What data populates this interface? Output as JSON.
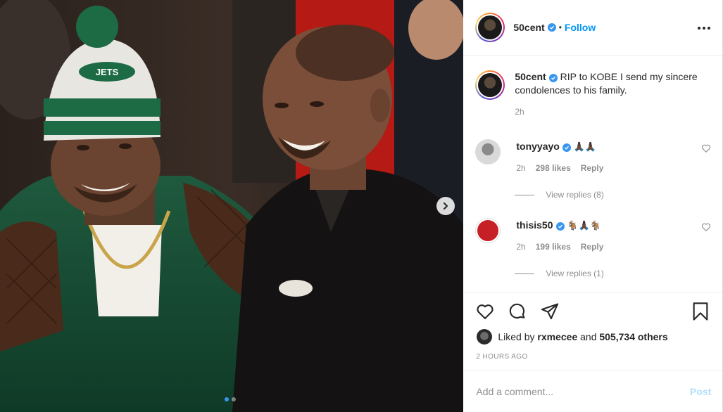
{
  "post": {
    "author": {
      "username": "50cent",
      "verified": true,
      "follow_label": "Follow",
      "separator": "•"
    },
    "media": {
      "slide_count": 2,
      "active_slide": 1,
      "next_icon": "chevron-right-icon"
    },
    "caption": {
      "username": "50cent",
      "text": "RIP to KOBE I send my sincere condolences to his family.",
      "time": "2h"
    },
    "comments": [
      {
        "username": "tonyyayo",
        "verified": true,
        "text": "🙏🏿🙏🏿",
        "time": "2h",
        "likes": "298 likes",
        "reply_label": "Reply",
        "view_replies": "View replies (8)"
      },
      {
        "username": "thisis50",
        "verified": true,
        "text": "🐐🙏🏿🐐",
        "time": "2h",
        "likes": "199 likes",
        "reply_label": "Reply",
        "view_replies": "View replies (1)"
      }
    ],
    "actions": {
      "icons": [
        "heart-icon",
        "comment-icon",
        "share-icon",
        "bookmark-icon"
      ]
    },
    "liked_by": {
      "prefix": "Liked by",
      "user": "rxmecee",
      "middle": "and",
      "others": "505,734 others"
    },
    "timestamp": "2 HOURS AGO",
    "add_comment": {
      "placeholder": "Add a comment...",
      "post_label": "Post"
    },
    "colors": {
      "link_blue": "#0095f6",
      "verified_blue": "#3897f0",
      "post_disabled": "#b2dffc",
      "muted": "#8e8e8e"
    }
  }
}
